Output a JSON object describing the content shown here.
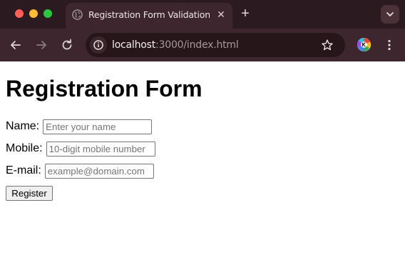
{
  "browser": {
    "tab": {
      "title": "Registration Form Validation",
      "close_glyph": "✕",
      "favicon": "globe-icon"
    },
    "new_tab_glyph": "+",
    "address_bar": {
      "host": "localhost",
      "path": ":3000/index.html"
    },
    "colors": {
      "tabstrip_bg": "#2b1a20",
      "toolbar_bg": "#3d262d",
      "omnibox_bg": "#261519"
    }
  },
  "page": {
    "title": "Registration Form",
    "fields": {
      "name": {
        "label": "Name:",
        "value": "",
        "placeholder": "Enter your name"
      },
      "mobile": {
        "label": "Mobile:",
        "value": "",
        "placeholder": "10-digit mobile number"
      },
      "email": {
        "label": "E-mail:",
        "value": "",
        "placeholder": "example@domain.com"
      }
    },
    "submit_label": "Register"
  }
}
